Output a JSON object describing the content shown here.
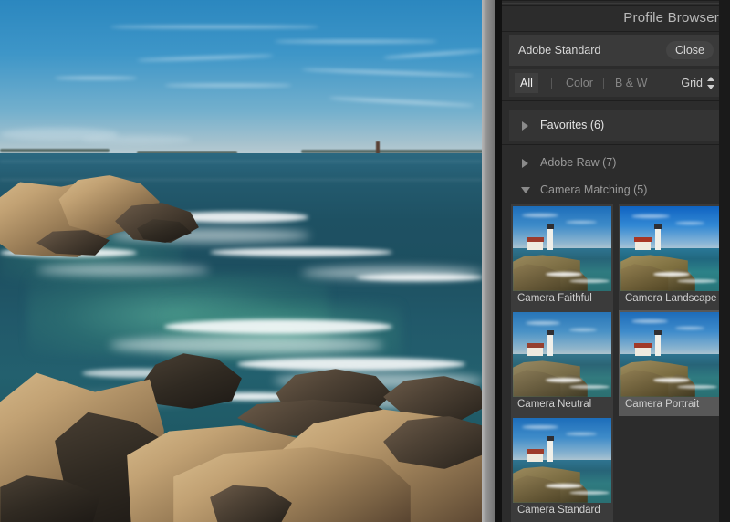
{
  "app": {
    "panel_title": "Profile Browser"
  },
  "profile_row": {
    "current_profile": "Adobe Standard",
    "close_label": "Close"
  },
  "filter_row": {
    "tabs": [
      {
        "label": "All",
        "active": true
      },
      {
        "label": "Color",
        "active": false
      },
      {
        "label": "B & W",
        "active": false
      }
    ],
    "view_mode": "Grid",
    "stepper_icon": "up-down-stepper-icon"
  },
  "groups": [
    {
      "name": "Favorites (6)",
      "expanded": false,
      "arrow_icon": "triangle-right-icon",
      "highlighted": true
    },
    {
      "name": "Adobe Raw (7)",
      "expanded": false,
      "arrow_icon": "triangle-right-icon",
      "highlighted": false
    },
    {
      "name": "Camera Matching (5)",
      "expanded": true,
      "arrow_icon": "triangle-down-icon",
      "highlighted": false
    }
  ],
  "thumbnails": [
    {
      "label": "Camera Faithful",
      "selected": false
    },
    {
      "label": "Camera Landscape",
      "selected": false
    },
    {
      "label": "Camera Neutral",
      "selected": false
    },
    {
      "label": "Camera Portrait",
      "selected": true
    },
    {
      "label": "Camera Standard",
      "selected": false
    }
  ],
  "colors": {
    "panel_bg": "#2c2c2c",
    "row_bg": "#3a3a3a",
    "selected_thumb_bg": "#585858",
    "text_bright": "#e2e2e2",
    "text_dim": "#9a9a9a",
    "divider": "#8f8f8f"
  },
  "photo": {
    "description": "Rocky coastal seascape with blue sky, horizon, and surf"
  }
}
